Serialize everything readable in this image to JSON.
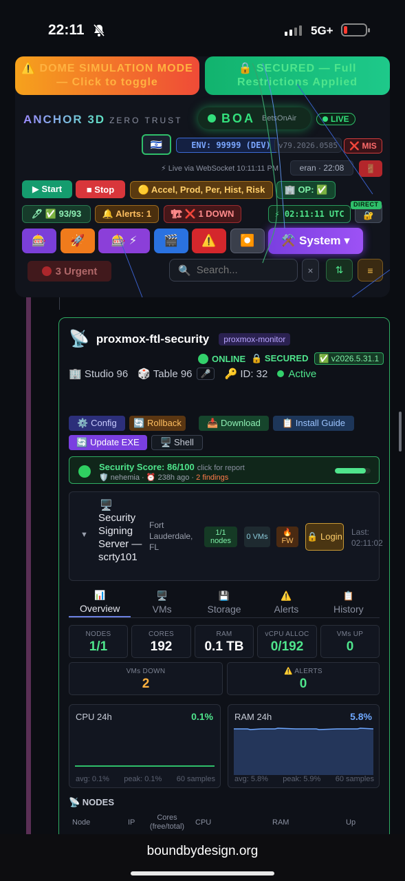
{
  "status_bar": {
    "time": "22:11",
    "network": "5G+"
  },
  "banners": {
    "dome": "⚠️ DOME SIMULATION MODE — Click to toggle",
    "secured": "🔒 SECURED — Full Restrictions Applied"
  },
  "header": {
    "brand": "ANCHOR 3D",
    "brand_sub": "ZERO TRUST",
    "boa": "BOA",
    "boa_sub": "BetsOnAir",
    "live": "LIVE",
    "flag": "🇮🇱",
    "env": "ENV: 99999 (DEV)",
    "version": "v79.2026.0585",
    "mis": "❌ MIS",
    "ws": "⚡ Live via WebSocket 10:11:11 PM",
    "user": "eran · 22:08",
    "exit_icon": "🚪"
  },
  "controls": {
    "start": "▶ Start",
    "stop": "■ Stop",
    "accel": "🟡 Accel, Prod, Per, Hist, Risk",
    "op": "🏢 OP: ✅",
    "count": "🖊 ✅ 93/93",
    "alerts": "🔔 Alerts: 1",
    "down": "🏗 ❌ 1 DOWN",
    "utc": "⚡ 02:11:11 UTC",
    "direct": "DIRECT",
    "direct_icon": "🔐",
    "icons": [
      "🎰",
      "🚀",
      "🎰 ⚡",
      "🎬",
      "⚠️",
      "⏺️"
    ],
    "system": "⚒️ System ▾",
    "urgent": "3 Urgent",
    "search_placeholder": "Search...",
    "clear": "×",
    "sort": "⇅",
    "menu": "≡"
  },
  "card": {
    "name": "proxmox-ftl-security",
    "tag": "proxmox-monitor",
    "online": "ONLINE",
    "secured": "🔒 SECURED",
    "version": "✅ v2026.5.31.1",
    "studio": "🏢 Studio 96",
    "table": "🎲 Table 96",
    "mic": "🎤",
    "id": "🔑 ID: 32",
    "active": "Active",
    "actions": {
      "config": "⚙️ Config",
      "rollback": "🔄 Rollback",
      "download": "📥 Download",
      "install": "📋 Install Guide",
      "update": "🔄 Update EXE",
      "shell": "🖥️ Shell"
    },
    "score": {
      "title": "Security Score: 86/100",
      "hint": "click for report",
      "by": "🛡️ nehemia · ⏰ 238h ago · ",
      "findings": "2 findings",
      "value": 86
    },
    "server": {
      "icon": "🖥️",
      "name": "Security Signing Server — scrty101",
      "location": "Fort Lauderdale, FL",
      "nodes": "1/1 nodes",
      "vms": "0 VMs",
      "fw": "🔥 FW",
      "login": "🔒 Login",
      "last": "Last: 02:11:02"
    },
    "tabs": [
      {
        "icon": "📊",
        "label": "Overview"
      },
      {
        "icon": "🖥️",
        "label": "VMs"
      },
      {
        "icon": "💾",
        "label": "Storage"
      },
      {
        "icon": "⚠️",
        "label": "Alerts"
      },
      {
        "icon": "📋",
        "label": "History"
      }
    ],
    "stats": {
      "nodes": {
        "label": "NODES",
        "value": "1/1"
      },
      "cores": {
        "label": "CORES",
        "value": "192"
      },
      "ram": {
        "label": "RAM",
        "value": "0.1 TB"
      },
      "vcpu": {
        "label": "vCPU ALLOC",
        "value": "0/192"
      },
      "vms_up": {
        "label": "VMs UP",
        "value": "0"
      },
      "vms_down": {
        "label": "VMs DOWN",
        "value": "2"
      },
      "alerts": {
        "label": "⚠️ ALERTS",
        "value": "0"
      }
    },
    "cpu": {
      "title": "CPU 24h",
      "value": "0.1%",
      "avg": "avg: 0.1%",
      "peak": "peak: 0.1%",
      "samples": "60 samples"
    },
    "ram": {
      "title": "RAM 24h",
      "value": "5.8%",
      "avg": "avg: 5.8%",
      "peak": "peak: 5.9%",
      "samples": "60 samples"
    },
    "nodes_header": "📡 NODES",
    "nodes_cols": [
      "Node",
      "IP",
      "Cores (free/total)",
      "CPU",
      "RAM",
      "Up"
    ]
  },
  "url": "boundbydesign.org"
}
